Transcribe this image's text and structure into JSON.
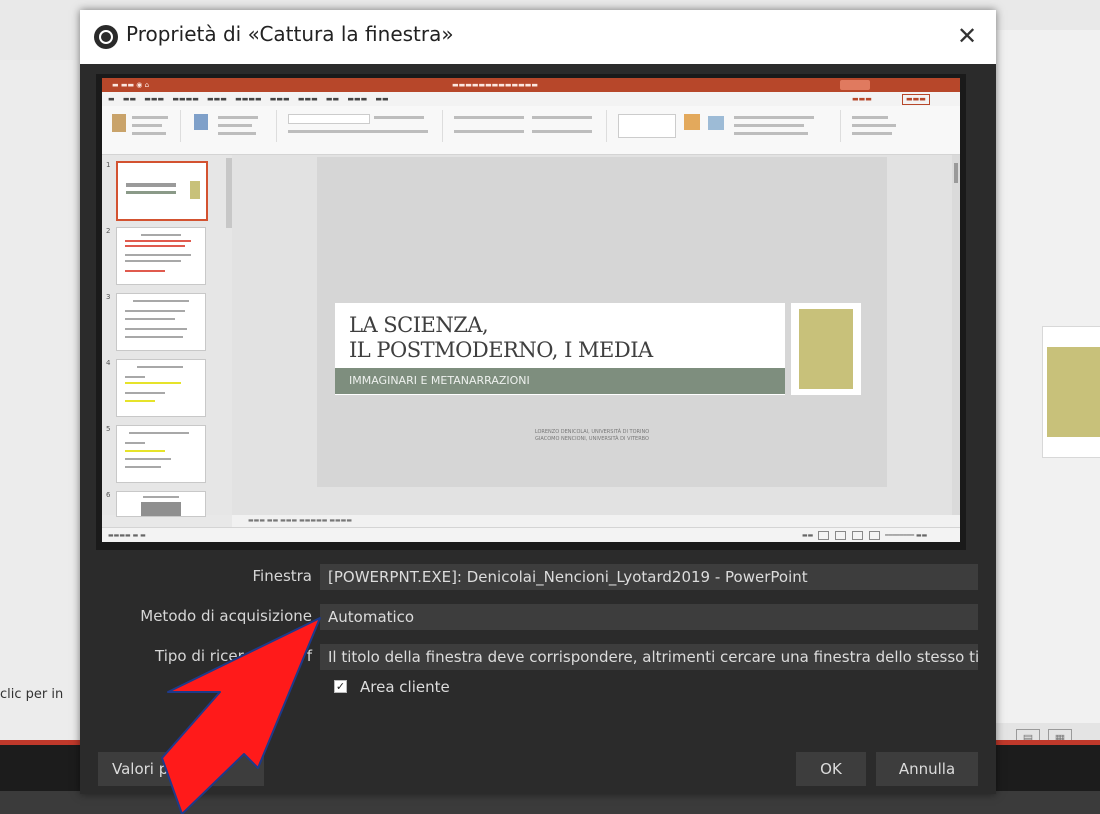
{
  "background": {
    "left_partial_text": "clic per in"
  },
  "dialog": {
    "title": "Proprietà di «Cattura la finestra»",
    "close_symbol": "✕",
    "fields": [
      {
        "label": "Finestra",
        "value": "[POWERPNT.EXE]: Denicolai_Nencioni_Lyotard2019 - PowerPoint"
      },
      {
        "label": "Metodo di acquisizione",
        "value": "Automatico"
      },
      {
        "label": "Tipo di ricerca della f",
        "value": "Il titolo della finestra deve corrispondere, altrimenti cercare una finestra dello stesso tipo"
      }
    ],
    "checkbox": {
      "label": "Area cliente",
      "checked": true,
      "mark": "✓"
    },
    "buttons": {
      "defaults": "Valori pre",
      "ok": "OK",
      "cancel": "Annulla"
    }
  },
  "preview": {
    "slide": {
      "title_line1": "LA SCIENZA,",
      "title_line2": "IL POSTMODERNO, I MEDIA",
      "subtitle": "IMMAGINARI E METANARRAZIONI",
      "authors": "LORENZO DENICOLAI, UNIVERSITÀ DI TORINO\nGIACOMO NENCIONI, UNIVERSITÀ DI VITERBO"
    },
    "thumbnail_numbers": [
      "1",
      "2",
      "3",
      "4",
      "5",
      "6"
    ]
  },
  "colors": {
    "dialog_bg": "#2b2b2b",
    "field_bg": "#3d3d3d",
    "powerpoint_accent": "#b7472a",
    "slide_band": "#7e8e7e",
    "slide_gold": "#c8c17a",
    "annotation_arrow": "#ff1a1a"
  }
}
